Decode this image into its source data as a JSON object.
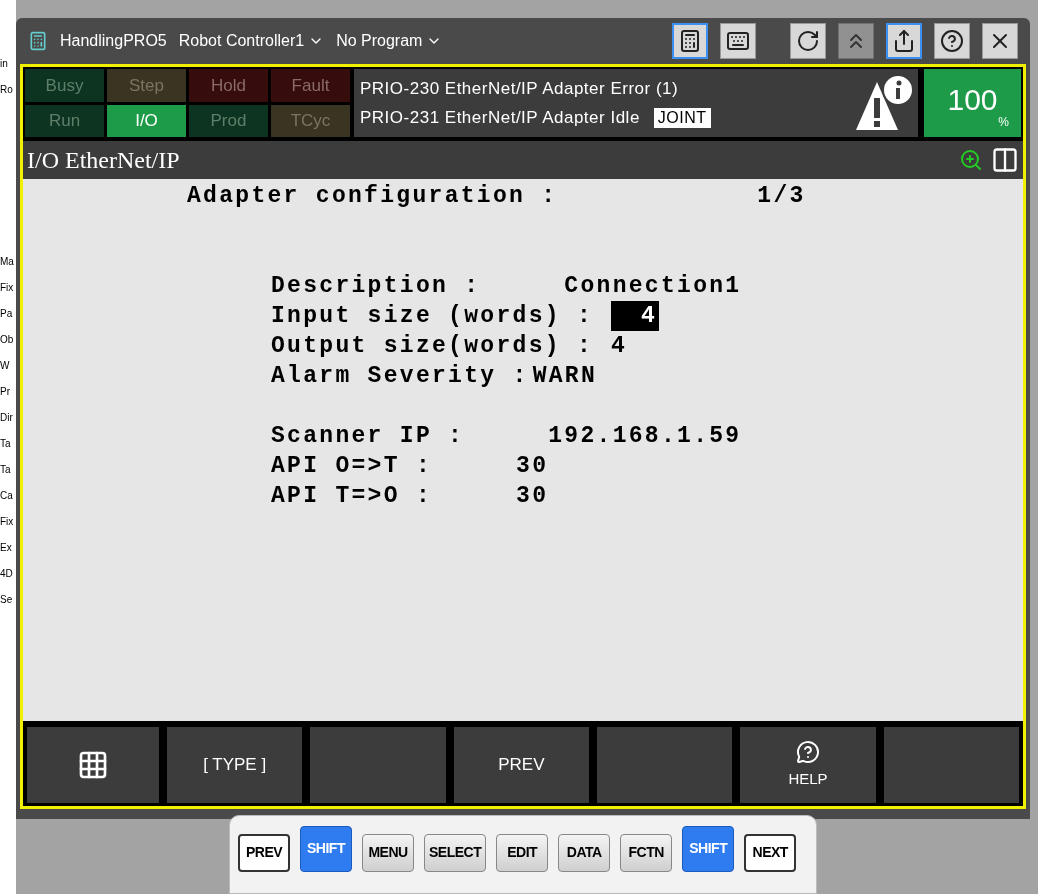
{
  "background_strip": [
    "in",
    "Ro",
    "Ma",
    "Fix",
    "Pa",
    "Ob",
    "W",
    "Pr",
    "Dir",
    "Ta",
    "Ta",
    "Ca",
    "Fix",
    "Ex",
    "4D",
    "Se"
  ],
  "header": {
    "app": "HandlingPRO5",
    "controller": "Robot Controller1",
    "program": "No Program"
  },
  "toolbar": [
    {
      "kind": "pendant",
      "selected": true
    },
    {
      "kind": "keyboard",
      "selected": false
    },
    {
      "kind": "reset",
      "selected": false
    },
    {
      "kind": "jog",
      "selected": false,
      "disabled": true
    },
    {
      "kind": "share",
      "selected": true
    },
    {
      "kind": "help",
      "selected": false
    },
    {
      "kind": "close",
      "selected": false
    }
  ],
  "status_lamps": [
    {
      "label": "Busy",
      "kind": "green",
      "on": false
    },
    {
      "label": "Step",
      "kind": "amber",
      "on": false
    },
    {
      "label": "Hold",
      "kind": "red",
      "on": false
    },
    {
      "label": "Fault",
      "kind": "red",
      "on": false
    },
    {
      "label": "Run",
      "kind": "green",
      "on": false
    },
    {
      "label": "I/O",
      "kind": "green",
      "on": true
    },
    {
      "label": "Prod",
      "kind": "green",
      "on": false
    },
    {
      "label": "TCyc",
      "kind": "amber",
      "on": false
    }
  ],
  "messages": [
    "PRIO-230 EtherNet/IP Adapter Error (1)",
    "PRIO-231 EtherNet/IP Adapter Idle"
  ],
  "mode": "JOINT",
  "override": {
    "value": "100",
    "unit": "%"
  },
  "screen_title": "I/O EtherNet/IP",
  "heading": {
    "text": "Adapter configuration :",
    "page": "1/3"
  },
  "fields": [
    {
      "label": "Description :",
      "value": "Connection1",
      "selected": false
    },
    {
      "label": "Input size (words) :",
      "value": "4",
      "selected": true
    },
    {
      "label": "Output size(words) :",
      "value": "4",
      "selected": false
    },
    {
      "label": "Alarm Severity :",
      "value": "WARN",
      "selected": false
    },
    {
      "label": "Scanner IP :",
      "value": "192.168.1.59",
      "selected": false
    },
    {
      "label": "API O=>T :",
      "value": "30",
      "selected": false
    },
    {
      "label": "API T=>O :",
      "value": "30",
      "selected": false
    }
  ],
  "function_keys": [
    {
      "kind": "menu"
    },
    {
      "kind": "text",
      "label": "[ TYPE ]"
    },
    {
      "kind": "blank"
    },
    {
      "kind": "text",
      "label": "PREV"
    },
    {
      "kind": "blank"
    },
    {
      "kind": "help",
      "label": "HELP"
    },
    {
      "kind": "blank"
    }
  ],
  "keys": [
    {
      "label": "PREV",
      "kind": "outlined"
    },
    {
      "label": "SHIFT",
      "kind": "blue"
    },
    {
      "label": "MENU",
      "kind": "grey"
    },
    {
      "label": "SELECT",
      "kind": "grey"
    },
    {
      "label": "EDIT",
      "kind": "grey"
    },
    {
      "label": "DATA",
      "kind": "grey"
    },
    {
      "label": "FCTN",
      "kind": "grey"
    },
    {
      "label": "SHIFT",
      "kind": "blue"
    },
    {
      "label": "NEXT",
      "kind": "outlined"
    }
  ]
}
